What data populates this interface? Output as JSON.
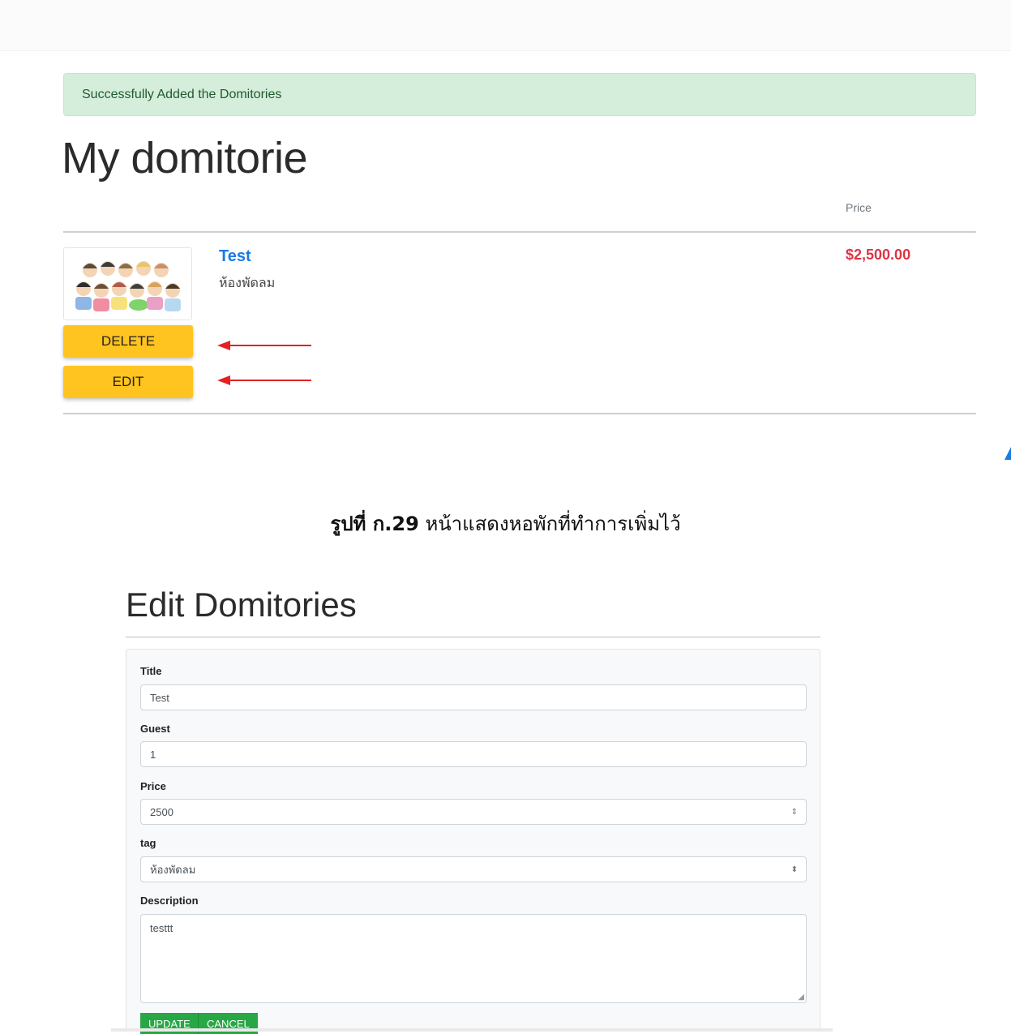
{
  "alert": {
    "text": "Successfully Added the Domitories"
  },
  "page_title": "My domitorie",
  "table": {
    "price_header": "Price"
  },
  "item": {
    "title": "Test",
    "tag": "ห้องพัดลม",
    "price": "$2,500.00",
    "delete_label": "DELETE",
    "edit_label": "EDIT"
  },
  "caption": {
    "figure_label": "รูปที่ ก.29",
    "figure_text": "หน้าแสดงหอพักที่ทำการเพิ่มไว้"
  },
  "edit": {
    "heading": "Edit Domitories",
    "title_label": "Title",
    "title_value": "Test",
    "guest_label": "Guest",
    "guest_value": "1",
    "price_label": "Price",
    "price_value": "2500",
    "tag_label": "tag",
    "tag_value": "ห้องพัดลม",
    "description_label": "Description",
    "description_value": "testtt",
    "update_label": "UPDATE",
    "cancel_label": "CANCEL"
  },
  "colors": {
    "alert_bg": "#d5eddb",
    "button_yellow": "#ffc41f",
    "title_link": "#1a7be3",
    "price_red": "#dc3545",
    "button_green": "#28a745",
    "annotation_arrow": "#e32222"
  },
  "icons": [
    "number-spinner-icon",
    "select-caret-icon",
    "textarea-resize-icon",
    "annotation-arrow-icon"
  ]
}
